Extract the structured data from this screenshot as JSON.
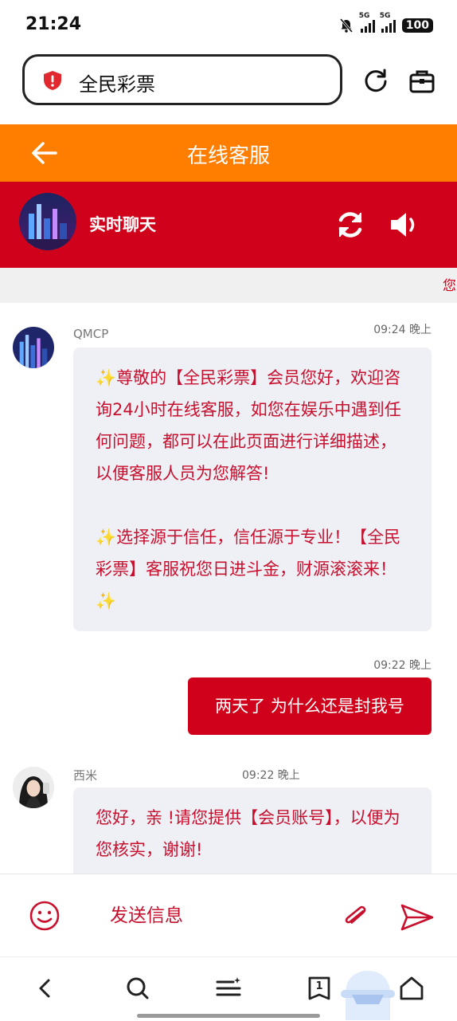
{
  "status_bar": {
    "time": "21:24",
    "network_1": "5G",
    "network_2": "5G",
    "battery": "100"
  },
  "browser": {
    "site_title": "全民彩票",
    "icons": [
      "shield-icon",
      "reload-icon",
      "toolbox-icon"
    ]
  },
  "header": {
    "title": "在线客服"
  },
  "chat_bar": {
    "title": "实时聊天"
  },
  "notice": {
    "text": "您"
  },
  "messages": [
    {
      "sender": "QMCP",
      "time": "09:24 晚上",
      "paragraph_1": "✨尊敬的【全民彩票】会员您好，欢迎咨询24小时在线客服，如您在娱乐中遇到任何问题，都可以在此页面进行详细描述，以便客服人员为您解答!",
      "paragraph_2": "✨选择源于信任，信任源于专业！【全民彩票】客服祝您日进斗金，财源滚滚来！ ✨"
    },
    {
      "time": "09:22 晚上",
      "text": "两天了 为什么还是封我号"
    },
    {
      "sender": "西米",
      "time": "09:22 晚上",
      "text": "您好，亲 !请您提供【会员账号】，以便为您核实，谢谢!"
    }
  ],
  "input": {
    "placeholder": "发送信息"
  },
  "nav": {
    "tabs_count": "1"
  },
  "colors": {
    "orange_header": "#ff7e00",
    "red_accent": "#d0021b",
    "bubble_bg": "#eef0f5"
  }
}
